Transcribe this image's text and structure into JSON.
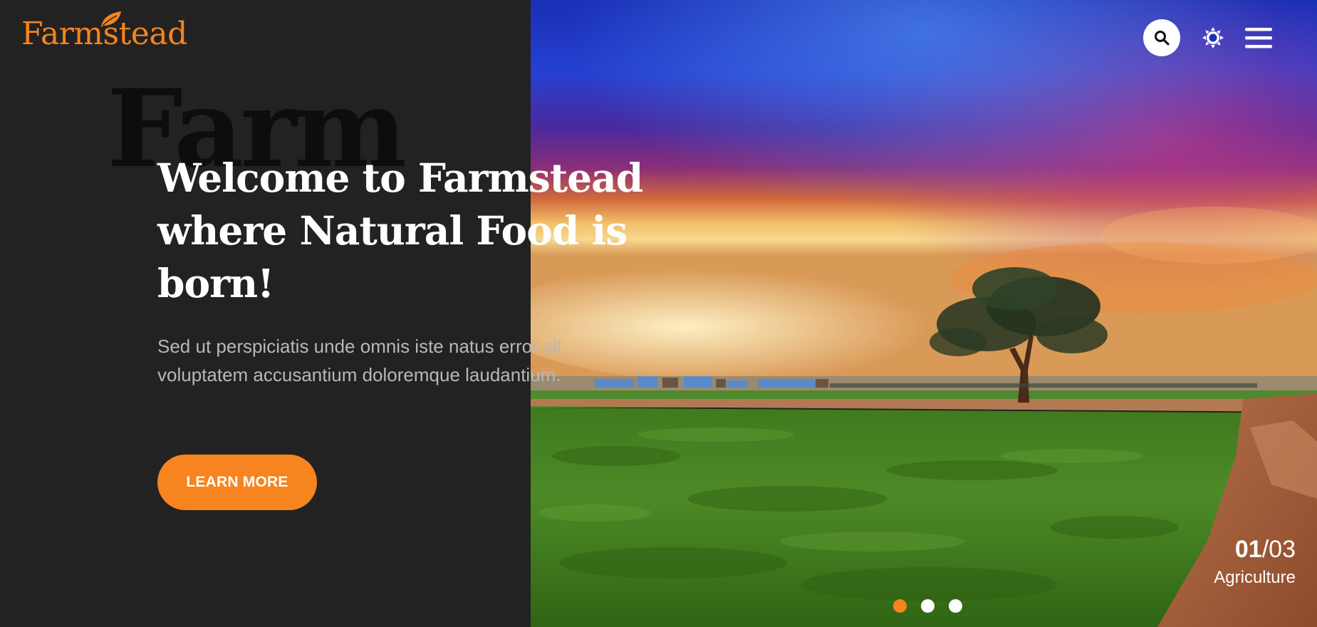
{
  "brand": {
    "logo_text": "Farmstead",
    "accent_color": "#f7841e",
    "logo_icon": "leaf-icon"
  },
  "header": {
    "search_icon": "search-icon",
    "theme_icon": "sun-icon",
    "menu_icon": "hamburger-menu-icon"
  },
  "hero": {
    "background_word": "Farm",
    "title": "Welcome to Farmstead where Natural Food is born!",
    "subtitle": "Sed ut perspiciatis unde omnis iste natus error sit voluptatem accusantium doloremque laudantium.",
    "cta_label": "LEARN MORE"
  },
  "slider": {
    "current": "01",
    "separator": "/",
    "total": "03",
    "category": "Agriculture",
    "active_index": 0,
    "dot_count": 3
  },
  "colors": {
    "dark_panel": "#222222",
    "accent": "#f7841e",
    "text_muted": "#b8b8b8"
  }
}
